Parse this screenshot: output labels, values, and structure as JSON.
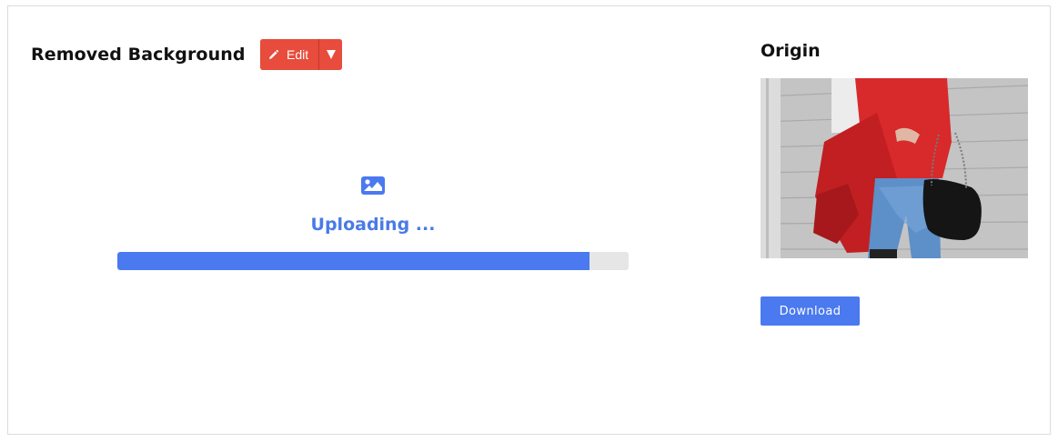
{
  "left_panel": {
    "title": "Removed Background",
    "edit_label": "Edit",
    "status_text": "Uploading ...",
    "progress_fraction": 0.924
  },
  "right_panel": {
    "title": "Origin",
    "download_label": "Download"
  },
  "colors": {
    "accent_blue": "#4a79f0",
    "edit_red": "#e74c3c",
    "progress_track": "#e6e6e6"
  },
  "icons": {
    "edit": "pencil-icon",
    "dropdown": "caret-down-icon",
    "upload": "image-icon"
  }
}
